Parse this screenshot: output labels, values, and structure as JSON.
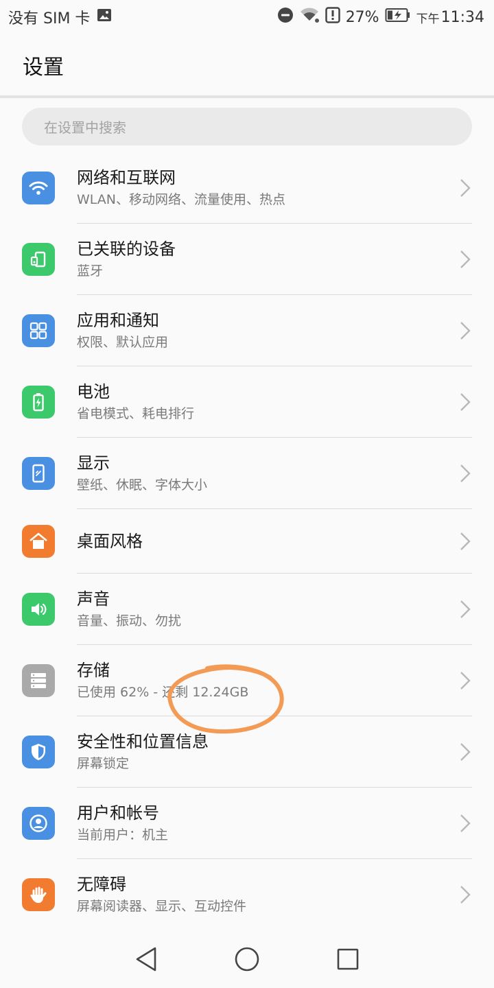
{
  "status_bar": {
    "carrier": "没有 SIM 卡",
    "battery_percent": "27%",
    "time_prefix": "下午",
    "time": "11:34",
    "icons": [
      "image-icon",
      "dnd-icon",
      "wifi-icon",
      "alert-icon",
      "battery-charging-icon"
    ]
  },
  "header": {
    "title": "设置"
  },
  "search": {
    "placeholder": "在设置中搜索"
  },
  "colors": {
    "blue": "#4a90e2",
    "green": "#3cc96b",
    "orange": "#f17b2f",
    "gray": "#a9a9a9",
    "annotation": "#f39a55"
  },
  "items": [
    {
      "title": "网络和互联网",
      "subtitle": "WLAN、移动网络、流量使用、热点",
      "icon": "wifi-icon",
      "color": "#4a90e2"
    },
    {
      "title": "已关联的设备",
      "subtitle": "蓝牙",
      "icon": "devices-icon",
      "color": "#3cc96b"
    },
    {
      "title": "应用和通知",
      "subtitle": "权限、默认应用",
      "icon": "apps-grid-icon",
      "color": "#4a90e2"
    },
    {
      "title": "电池",
      "subtitle": "省电模式、耗电排行",
      "icon": "battery-icon",
      "color": "#3cc96b"
    },
    {
      "title": "显示",
      "subtitle": "壁纸、休眠、字体大小",
      "icon": "display-icon",
      "color": "#4a90e2"
    },
    {
      "title": "桌面风格",
      "subtitle": "",
      "icon": "home-icon",
      "color": "#f17b2f"
    },
    {
      "title": "声音",
      "subtitle": "音量、振动、勿扰",
      "icon": "speaker-icon",
      "color": "#3cc96b"
    },
    {
      "title": "存储",
      "subtitle": "已使用 62% - 还剩 12.24GB",
      "icon": "storage-icon",
      "color": "#a9a9a9"
    },
    {
      "title": "安全性和位置信息",
      "subtitle": "屏幕锁定",
      "icon": "shield-icon",
      "color": "#4a90e2"
    },
    {
      "title": "用户和帐号",
      "subtitle": "当前用户：机主",
      "icon": "user-icon",
      "color": "#4a90e2"
    },
    {
      "title": "无障碍",
      "subtitle": "屏幕阅读器、显示、互动控件",
      "icon": "hand-icon",
      "color": "#f17b2f"
    }
  ],
  "nav": {
    "icons": [
      "back-icon",
      "home-circle-icon",
      "recents-icon"
    ]
  }
}
